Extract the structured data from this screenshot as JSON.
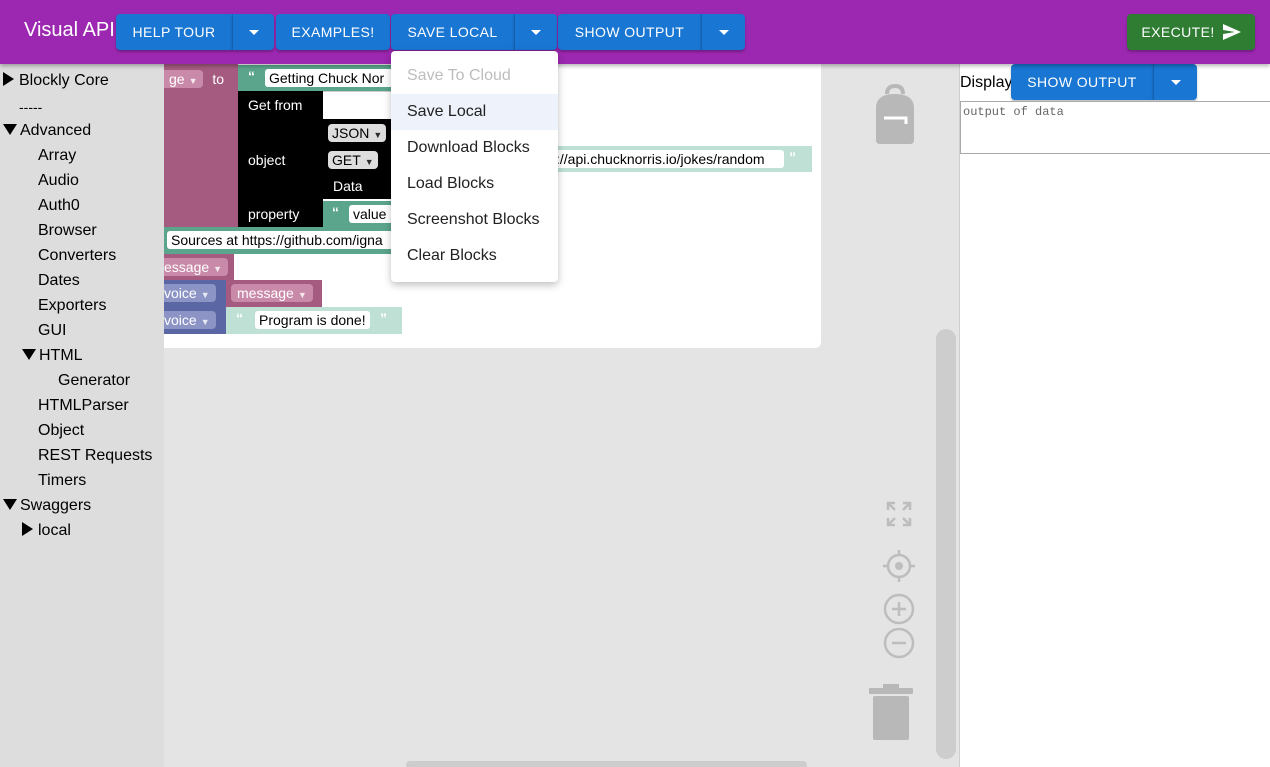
{
  "app": {
    "title": "Visual API"
  },
  "toolbar": {
    "help_tour": "HELP TOUR",
    "examples": "EXAMPLES!",
    "save_local": "SAVE LOCAL",
    "show_output": "SHOW OUTPUT",
    "execute": "EXECUTE!"
  },
  "sidebar": {
    "items": [
      {
        "label": "Blockly Core",
        "toggle": "collapsed"
      },
      {
        "label": "-----"
      },
      {
        "label": "Advanced",
        "toggle": "expanded"
      },
      {
        "label": "Array"
      },
      {
        "label": "Audio"
      },
      {
        "label": "Auth0"
      },
      {
        "label": "Browser"
      },
      {
        "label": "Converters"
      },
      {
        "label": "Dates"
      },
      {
        "label": "Exporters"
      },
      {
        "label": "GUI"
      },
      {
        "label": "HTML",
        "toggle": "expanded"
      },
      {
        "label": "Generator"
      },
      {
        "label": "HTMLParser"
      },
      {
        "label": "Object"
      },
      {
        "label": "REST Requests"
      },
      {
        "label": "Timers"
      },
      {
        "label": "Swaggers",
        "toggle": "expanded"
      },
      {
        "label": "local",
        "toggle": "collapsed"
      }
    ]
  },
  "blocks": {
    "to1": "to",
    "to2": "to",
    "var_suffix1": "ge",
    "var_suffix2": "ge",
    "getting": "Getting Chuck Nor",
    "get_from": "Get from",
    "object": "object",
    "property": "property",
    "json": "JSON",
    "get": "GET",
    "data": "Data",
    "url": "s://api.chucknorris.io/jokes/random",
    "value": "value",
    "sources": "Sources at https://github.com/igna",
    "message_var": "essage",
    "voice1": "voice",
    "voice2": "voice",
    "message": "message",
    "program_done": "Program is done!"
  },
  "menu": {
    "items": [
      {
        "label": "Save To Cloud",
        "disabled": true
      },
      {
        "label": "Save Local",
        "highlighted": true
      },
      {
        "label": "Download Blocks"
      },
      {
        "label": "Load Blocks"
      },
      {
        "label": "Screenshot Blocks"
      },
      {
        "label": "Clear Blocks"
      }
    ]
  },
  "right_panel": {
    "display_label": "Display",
    "show_output": "SHOW OUTPUT",
    "output_placeholder": "output of data"
  },
  "colors": {
    "appbar": "#9c27b0",
    "primary_button": "#1976d2",
    "execute_button": "#2e7d32",
    "block_variable": "#a55b80",
    "block_black": "#000000",
    "block_text": "#5ba58c",
    "block_voice": "#5b67a5"
  }
}
